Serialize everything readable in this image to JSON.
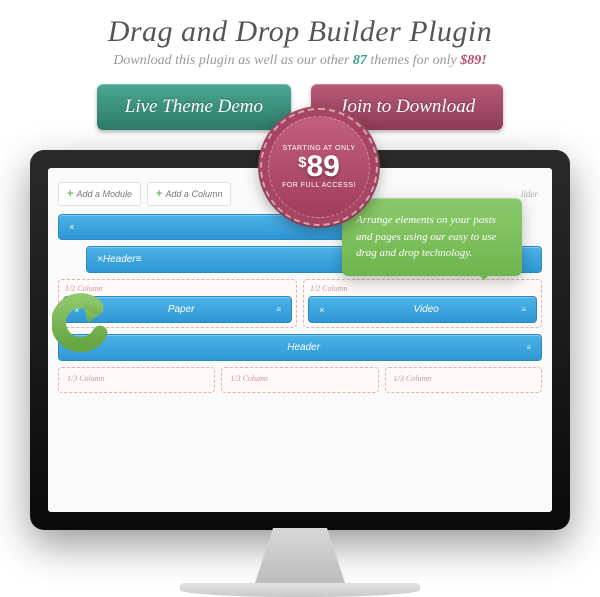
{
  "header": {
    "title": "Drag and Drop Builder Plugin",
    "subtitle_pre": "Download this plugin as well as our other ",
    "subtitle_count": "87",
    "subtitle_mid": " themes for only ",
    "subtitle_price": "$89!",
    "cta_demo": "Live Theme Demo",
    "cta_join": "Join to Download"
  },
  "badge": {
    "top_text": "STARTING AT ONLY",
    "price_dollar": "$",
    "price_amount": "89",
    "bottom_text": "FOR FULL ACCESS!"
  },
  "tooltip": {
    "text": "Arrange elements on your posts and pages using our easy to use drag and drop technology."
  },
  "builder": {
    "toolbar": {
      "add_module": "Add a Module",
      "add_column": "Add a Column",
      "hint": "ilder"
    },
    "blocks": {
      "close": "×",
      "header1": "Header",
      "paper": "Paper",
      "video": "Video",
      "header2": "Header",
      "col_half": "1/2 Column",
      "col_third": "1/3 Column"
    }
  }
}
